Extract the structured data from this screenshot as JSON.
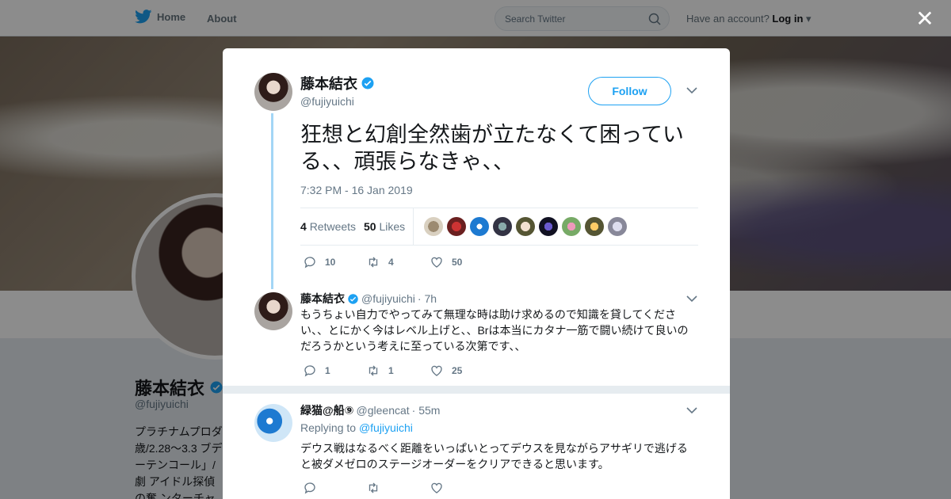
{
  "nav": {
    "home_label": "Home",
    "about_label": "About",
    "search_placeholder": "Search Twitter",
    "account_prompt": "Have an account?",
    "login_label": "Log in"
  },
  "profile": {
    "name": "藤本結衣",
    "handle": "@fujiyuichi",
    "bio": "プラチナムプロダ 歳/2.28〜3.3 ブデ ーテンコール」/劇 アイドル探偵の奮 ンターチャレンジ"
  },
  "tweet": {
    "author_name": "藤本結衣",
    "author_handle": "@fujiyuichi",
    "follow_label": "Follow",
    "text": "狂想と幻創全然歯が立たなくて困っている、、頑張らなきゃ、、",
    "timestamp": "7:32 PM - 16 Jan 2019",
    "retweets_count": "4",
    "retweets_label": "Retweets",
    "likes_count": "50",
    "likes_label": "Likes",
    "reply_count": "10",
    "retweet_action_count": "4",
    "like_action_count": "50"
  },
  "replies": [
    {
      "author_name": "藤本結衣",
      "author_handle": "@fujiyuichi",
      "time": "· 7h",
      "text": "もうちょい自力でやってみて無理な時は助け求めるので知識を貸してください、、とにかく今はレベル上げと、、Brは本当にカタナ一筋で闘い続けて良いのだろうかという考えに至っている次第です、、",
      "reply_count": "1",
      "retweet_count": "1",
      "like_count": "25"
    },
    {
      "author_name": "緑猫@船⑨",
      "author_handle": "@gleencat",
      "time": "· 55m",
      "replying_prefix": "Replying to",
      "replying_to": "@fujiyuichi",
      "text": "デウス戦はなるべく距離をいっぱいとってデウスを見ながらアサギリで逃げると被ダメゼロのステージオーダーをクリアできると思います。"
    }
  ],
  "colors": {
    "accent": "#1da1f2",
    "thread_line": "#a3d6f6",
    "muted": "#657786"
  }
}
